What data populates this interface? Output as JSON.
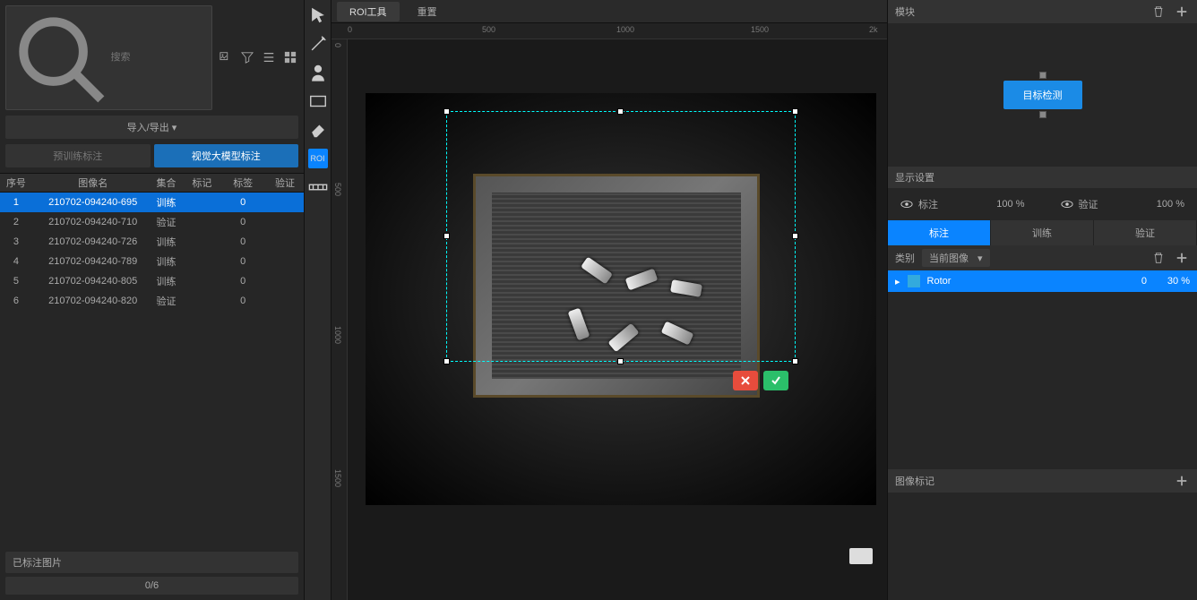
{
  "search": {
    "placeholder": "搜索"
  },
  "import_export": "导入/导出 ▾",
  "pretrain_btn": "预训练标注",
  "bigmodel_btn": "视觉大模型标注",
  "cols": {
    "idx": "序号",
    "name": "图像名",
    "set": "集合",
    "mark": "标记",
    "tag": "标签",
    "ver": "验证"
  },
  "rows": [
    {
      "idx": "1",
      "name": "210702-094240-695",
      "set": "训练",
      "tag": "0"
    },
    {
      "idx": "2",
      "name": "210702-094240-710",
      "set": "验证",
      "tag": "0"
    },
    {
      "idx": "3",
      "name": "210702-094240-726",
      "set": "训练",
      "tag": "0"
    },
    {
      "idx": "4",
      "name": "210702-094240-789",
      "set": "训练",
      "tag": "0"
    },
    {
      "idx": "5",
      "name": "210702-094240-805",
      "set": "训练",
      "tag": "0"
    },
    {
      "idx": "6",
      "name": "210702-094240-820",
      "set": "验证",
      "tag": "0"
    }
  ],
  "labeled": "已标注图片",
  "progress": "0/6",
  "top_tabs": {
    "roi": "ROI工具",
    "reset": "重置"
  },
  "ruler": {
    "h": [
      "0",
      "500",
      "1000",
      "1500",
      "2k"
    ],
    "v": [
      "0",
      "500",
      "1000",
      "1500"
    ]
  },
  "tool_roi": "ROI",
  "module": {
    "title": "模块",
    "node": "目标检测"
  },
  "display": {
    "title": "显示设置",
    "label": "标注",
    "label_pct": "100 %",
    "verify": "验证",
    "verify_pct": "100 %"
  },
  "tabs3": {
    "a": "标注",
    "b": "训练",
    "c": "验证"
  },
  "category": {
    "label": "类别",
    "dd": "当前图像"
  },
  "class1": {
    "name": "Rotor",
    "count": "0",
    "pct": "30 %"
  },
  "img_mark": "图像标记"
}
